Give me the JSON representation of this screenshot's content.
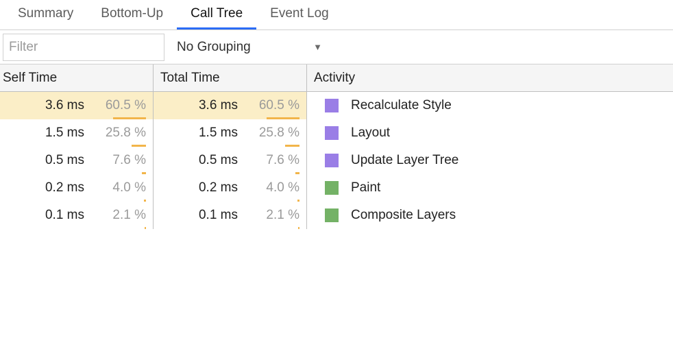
{
  "tabs": [
    {
      "label": "Summary",
      "active": false
    },
    {
      "label": "Bottom-Up",
      "active": false
    },
    {
      "label": "Call Tree",
      "active": true
    },
    {
      "label": "Event Log",
      "active": false
    }
  ],
  "filter": {
    "placeholder": "Filter",
    "value": ""
  },
  "grouping": {
    "label": "No Grouping"
  },
  "columns": {
    "self": "Self Time",
    "total": "Total Time",
    "activity": "Activity"
  },
  "rows": [
    {
      "self_ms": "3.6 ms",
      "self_pct": "60.5 %",
      "self_pct_num": 60.5,
      "total_ms": "3.6 ms",
      "total_pct": "60.5 %",
      "total_pct_num": 60.5,
      "fill_bg": true,
      "swatch": "purple",
      "activity": "Recalculate Style"
    },
    {
      "self_ms": "1.5 ms",
      "self_pct": "25.8 %",
      "self_pct_num": 25.8,
      "total_ms": "1.5 ms",
      "total_pct": "25.8 %",
      "total_pct_num": 25.8,
      "fill_bg": false,
      "swatch": "purple",
      "activity": "Layout"
    },
    {
      "self_ms": "0.5 ms",
      "self_pct": "7.6 %",
      "self_pct_num": 7.6,
      "total_ms": "0.5 ms",
      "total_pct": "7.6 %",
      "total_pct_num": 7.6,
      "fill_bg": false,
      "swatch": "purple",
      "activity": "Update Layer Tree"
    },
    {
      "self_ms": "0.2 ms",
      "self_pct": "4.0 %",
      "self_pct_num": 4.0,
      "total_ms": "0.2 ms",
      "total_pct": "4.0 %",
      "total_pct_num": 4.0,
      "fill_bg": false,
      "swatch": "green",
      "activity": "Paint"
    },
    {
      "self_ms": "0.1 ms",
      "self_pct": "2.1 %",
      "self_pct_num": 2.1,
      "total_ms": "0.1 ms",
      "total_pct": "2.1 %",
      "total_pct_num": 2.1,
      "fill_bg": false,
      "swatch": "green",
      "activity": "Composite Layers"
    }
  ]
}
